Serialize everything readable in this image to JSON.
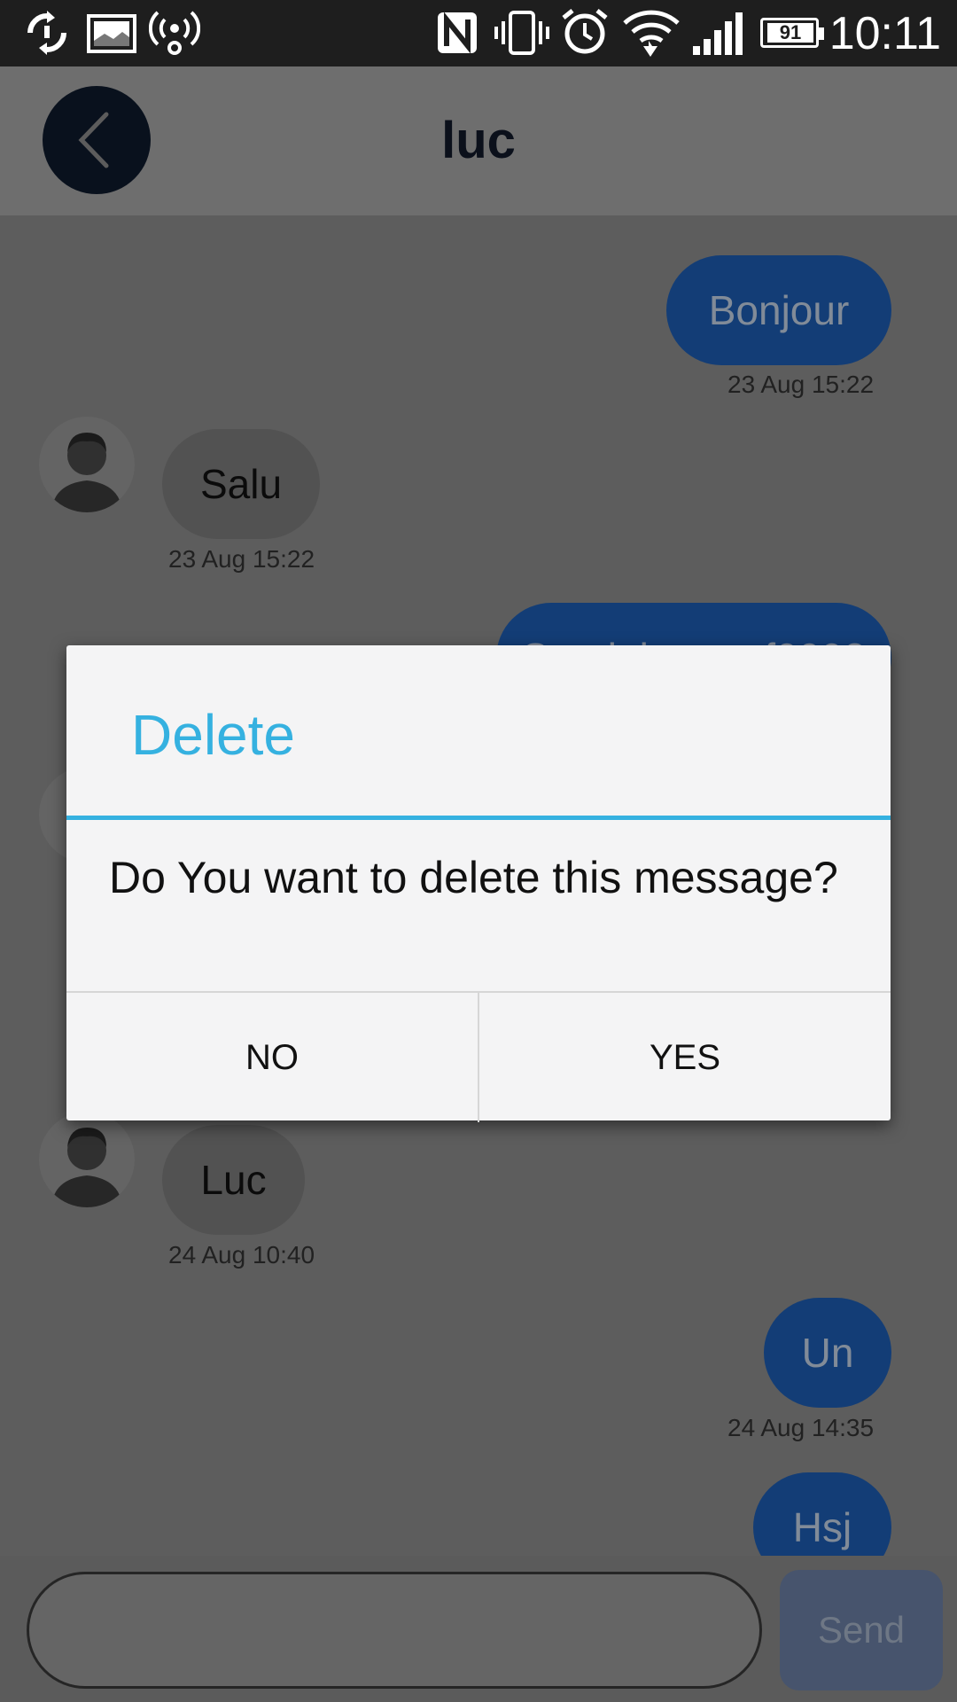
{
  "status_bar": {
    "time": "10:11",
    "battery_level": "91",
    "icons": [
      "sync-icon",
      "image-notification-icon",
      "hotspot-icon",
      "nfc-icon",
      "vibrate-icon",
      "alarm-icon",
      "wifi-icon",
      "signal-icon",
      "battery-icon"
    ]
  },
  "header": {
    "title": "luc",
    "back_icon": "chevron-left-icon"
  },
  "messages": [
    {
      "side": "out",
      "text": "Bonjour",
      "time": "23 Aug 15:22"
    },
    {
      "side": "in",
      "text": "Salu",
      "time": "23 Aug 15:22"
    },
    {
      "side": "out",
      "text": "Sandobeo nof0093",
      "time": ""
    },
    {
      "side": "in",
      "text": "Luc",
      "time": "24 Aug 10:40"
    },
    {
      "side": "out",
      "text": "Un",
      "time": "24 Aug 14:35"
    },
    {
      "side": "out",
      "text": "Hsj",
      "time": ""
    }
  ],
  "composer": {
    "placeholder": "",
    "send_label": "Send"
  },
  "dialog": {
    "title": "Delete",
    "message": "Do You want to delete this message?",
    "no_label": "NO",
    "yes_label": "YES"
  },
  "colors": {
    "accent": "#35b1e0",
    "outgoing_bubble": "#0058c8",
    "header_dark": "#0f1b2d"
  }
}
